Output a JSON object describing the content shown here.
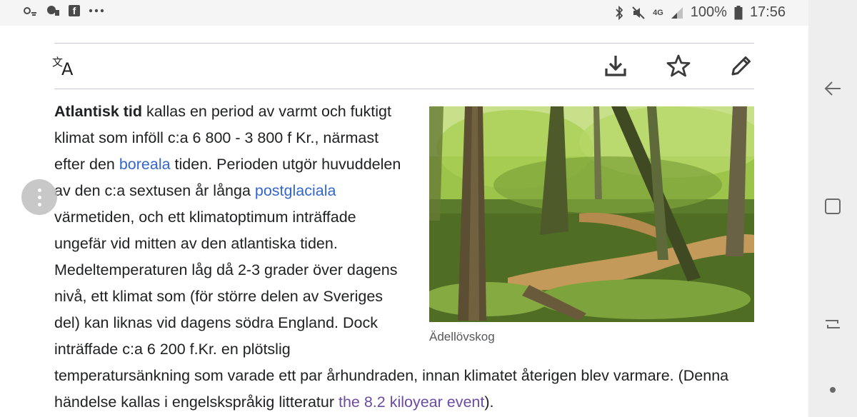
{
  "status_bar": {
    "battery_percent": "100%",
    "time": "17:56",
    "network_label": "4G",
    "left_icons": [
      "weather-icon",
      "notification-icon",
      "facebook-icon",
      "more-dots-icon"
    ],
    "right_icons": [
      "bluetooth-icon",
      "mute-icon",
      "network-icon",
      "signal-icon",
      "battery-icon"
    ]
  },
  "toolbar": {
    "icons": [
      "translate-icon",
      "download-icon",
      "star-icon",
      "edit-pencil-icon"
    ]
  },
  "article": {
    "bold_term": "Atlantisk tid",
    "seg1": " kallas en period av varmt och fuktigt klimat som inföll c:a 6 800 - 3 800 f Kr., närmast efter den ",
    "link1": "boreala",
    "seg2": " tiden. Perioden utgör huvuddelen av den c:a sextusen år långa ",
    "link2": "postglaciala",
    "seg3": " värmetiden, och ett klimatoptimum inträffade ungefär vid mitten av den atlantiska tiden. Medeltemperaturen låg då 2-3 grader över dagens nivå, ett klimat som (för större delen av Sveriges del) kan liknas vid dagens södra England. Dock inträffade c:a 6 200 f.Kr. en plötslig temperatursänkning som varade ett par århundraden, innan klimatet återigen blev varmare. (Denna händelse kallas i engelskspråkig litteratur ",
    "link3": "the 8.2 kiloyear event",
    "seg4": ").",
    "figure_caption": "Ädellövskog"
  },
  "nav_bar": {
    "icons": [
      "back-icon",
      "recents-icon",
      "overview-icon",
      "dot-indicator"
    ]
  },
  "colors": {
    "link": "#3366cc",
    "visited_link": "#6b4ba1",
    "text": "#202122",
    "caption": "#54595d"
  }
}
